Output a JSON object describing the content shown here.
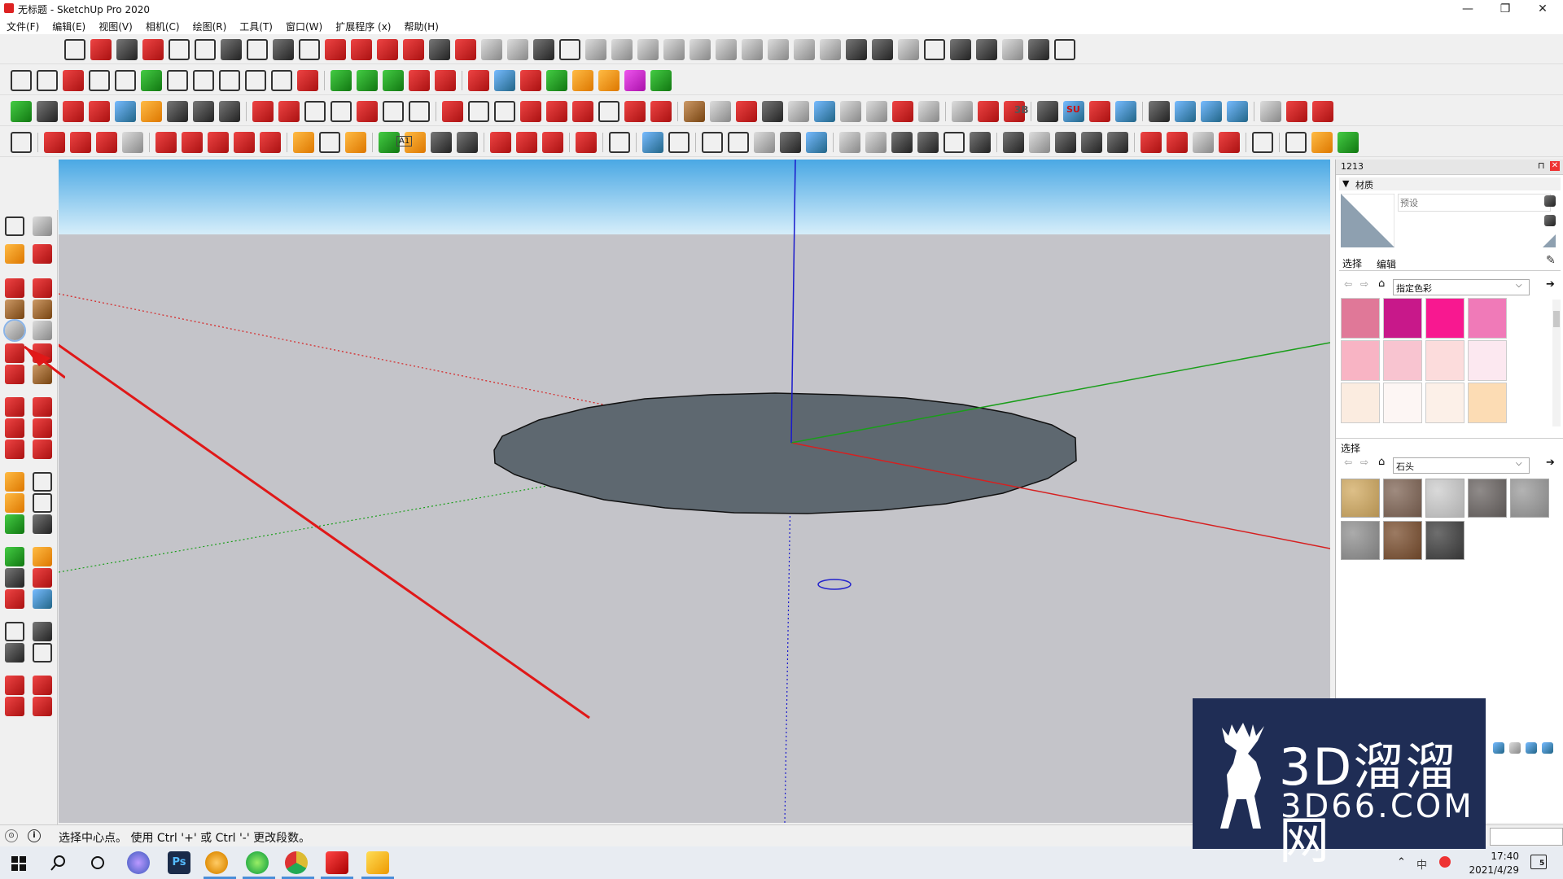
{
  "window": {
    "title": "无标题 - SketchUp Pro 2020",
    "minimize": "—",
    "restore": "❐",
    "close": "✕"
  },
  "menu": [
    "文件(F)",
    "编辑(E)",
    "视图(V)",
    "相机(C)",
    "绘图(R)",
    "工具(T)",
    "窗口(W)",
    "扩展程序 (x)",
    "帮助(H)"
  ],
  "toolbar": {
    "badge_3b": "3B",
    "badge_su": "SU",
    "badge_a1": "A1"
  },
  "panel": {
    "header_id": "1213",
    "materials_title": "材质",
    "name_placeholder": "预设",
    "tab_select": "选择",
    "tab_edit": "编辑",
    "library1": "指定色彩",
    "section2_title": "选择",
    "library2": "石头",
    "swatches": [
      "#e07898",
      "#c8188a",
      "#f81890",
      "#f07ab8",
      "#f8b4c4",
      "#f8c4d0",
      "#fcdcdc",
      "#fce8f0",
      "#fbece0",
      "#fdf6f4",
      "#fcf0e8",
      "#fcdcb4"
    ],
    "textures": [
      "#d2aa60",
      "#7f6454",
      "#cdcdcd",
      "#6a6462",
      "#9a9a9a",
      "#8f8f8f",
      "#7a4e2e",
      "#3e3e3e"
    ]
  },
  "status": {
    "message": "选择中心点。 使用 Ctrl '+' 或 Ctrl '-' 更改段数。"
  },
  "taskbar": {
    "time": "17:40",
    "date": "2021/4/29",
    "ime": "中",
    "notif_count": "5",
    "app_ps": "Ps"
  },
  "watermark": {
    "line1": "3D溜溜网",
    "line2": "3D66.COM"
  },
  "colors": {
    "sky_top": "#5fb3e6",
    "ground": "#c4c4c9",
    "disk": "#5e6870",
    "axis_red": "#d62020",
    "axis_green": "#1a9e1a",
    "axis_blue": "#1a1acc",
    "arrow": "#e01818"
  }
}
